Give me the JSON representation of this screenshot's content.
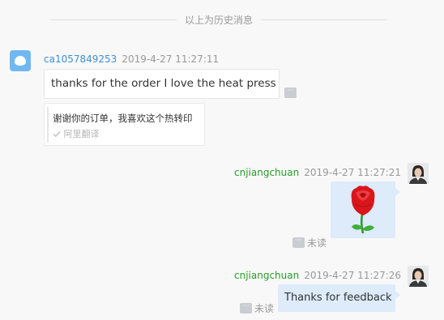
{
  "history_divider": "以上为历史消息",
  "colors": {
    "buyer_name": "#3d8fd8",
    "seller_name": "#2a9a2a",
    "outgoing_bubble": "#ddebfa",
    "incoming_bubble": "#ffffff",
    "buyer_avatar": "#6fb8f2"
  },
  "messages": [
    {
      "sender": "ca1057849253",
      "time": "2019-4-27 11:27:11",
      "text": "thanks for the order I love the heat press",
      "translation": {
        "text": "谢谢你的订单，我喜欢这个热转印",
        "source": "阿里翻译",
        "source_icon": "check-icon"
      },
      "more_icon": "ellipsis-icon"
    },
    {
      "sender": "cnjiangchuan",
      "time": "2019-4-27 11:27:21",
      "content_icon": "rose-emoji-icon",
      "status": "未读",
      "more_icon": "ellipsis-icon"
    },
    {
      "sender": "cnjiangchuan",
      "time": "2019-4-27 11:27:26",
      "text": "Thanks for feedback",
      "status": "未读",
      "more_icon": "ellipsis-icon"
    }
  ]
}
